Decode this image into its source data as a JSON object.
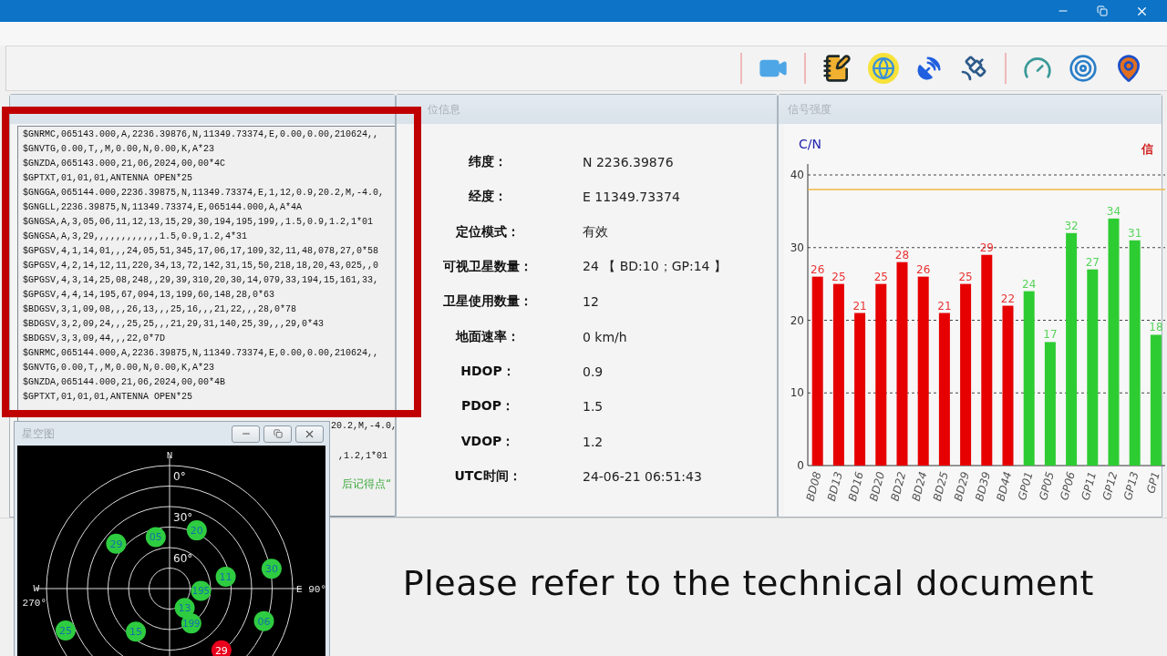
{
  "nmea_panel": {
    "lines": [
      "$GNRMC,065143.000,A,2236.39876,N,11349.73374,E,0.00,0.00,210624,,",
      "$GNVTG,0.00,T,,M,0.00,N,0.00,K,A*23",
      "$GNZDA,065143.000,21,06,2024,00,00*4C",
      "$GPTXT,01,01,01,ANTENNA OPEN*25",
      "$GNGGA,065144.000,2236.39875,N,11349.73374,E,1,12,0.9,20.2,M,-4.0,",
      "$GNGLL,2236.39875,N,11349.73374,E,065144.000,A,A*4A",
      "$GNGSA,A,3,05,06,11,12,13,15,29,30,194,195,199,,1.5,0.9,1.2,1*01",
      "$GNGSA,A,3,29,,,,,,,,,,,,1.5,0.9,1.2,4*31",
      "$GPGSV,4,1,14,01,,,24,05,51,345,17,06,17,109,32,11,48,078,27,0*58",
      "$GPGSV,4,2,14,12,11,220,34,13,72,142,31,15,50,218,18,20,43,025,,0",
      "$GPGSV,4,3,14,25,08,248,,29,39,310,20,30,14,079,33,194,15,161,33,",
      "$GPGSV,4,4,14,195,67,094,13,199,60,148,28,0*63",
      "$BDGSV,3,1,09,08,,,26,13,,,25,16,,,21,22,,,28,0*78",
      "$BDGSV,3,2,09,24,,,25,25,,,21,29,31,140,25,39,,,29,0*43",
      "$BDGSV,3,3,09,44,,,22,0*7D",
      "$GNRMC,065144.000,A,2236.39875,N,11349.73374,E,0.00,0.00,210624,,",
      "$GNVTG,0.00,T,,M,0.00,N,0.00,K,A*23",
      "$GNZDA,065144.000,21,06,2024,00,00*4B",
      "$GPTXT,01,01,01,ANTENNA OPEN*25"
    ],
    "covered_tails": [
      "20.2,M,-4.0,",
      ",1.2,1*01"
    ],
    "status_fragment": "后记得点“"
  },
  "position_panel": {
    "title": "位信息",
    "rows": [
      {
        "label": "纬度：",
        "value": "N 2236.39876"
      },
      {
        "label": "经度：",
        "value": "E 11349.73374"
      },
      {
        "label": "定位模式：",
        "value": "有效"
      },
      {
        "label": "可视卫星数量：",
        "value": "24 【 BD:10；GP:14 】"
      },
      {
        "label": "卫星使用数量：",
        "value": "12"
      },
      {
        "label": "地面速率：",
        "value": "0 km/h"
      },
      {
        "label": "HDOP：",
        "value": "0.9"
      },
      {
        "label": "PDOP：",
        "value": "1.5"
      },
      {
        "label": "VDOP：",
        "value": "1.2"
      },
      {
        "label": "UTC时间：",
        "value": "24-06-21 06:51:43"
      }
    ]
  },
  "signal_panel": {
    "title": "信号强度",
    "legend_fragment": "信",
    "chart_data": {
      "type": "bar",
      "ylabel": "C/N",
      "categories": [
        "BD08",
        "BD13",
        "BD16",
        "BD20",
        "BD22",
        "BD24",
        "BD25",
        "BD29",
        "BD39",
        "BD44",
        "GP01",
        "GP05",
        "GP06",
        "GP11",
        "GP12",
        "GP13",
        "GP1"
      ],
      "series": [
        {
          "color": "#e60000",
          "values": [
            26,
            25,
            21,
            25,
            28,
            26,
            21,
            25,
            29,
            22,
            null,
            null,
            null,
            null,
            null,
            null,
            null
          ]
        },
        {
          "color": "#2ecc33",
          "values": [
            null,
            null,
            null,
            null,
            null,
            null,
            null,
            null,
            null,
            null,
            24,
            17,
            32,
            27,
            34,
            31,
            18
          ]
        }
      ],
      "ylim": [
        0,
        40
      ],
      "yticks": [
        0,
        10,
        20,
        30,
        40
      ],
      "grid": true,
      "data_labels": true,
      "ref_lines": [
        {
          "axis": "y",
          "value": 38
        }
      ]
    }
  },
  "sky_window": {
    "title": "星空图",
    "compass_labels": [
      {
        "kind": "north",
        "text": "N"
      },
      {
        "kind": "east",
        "text": "E 90°"
      },
      {
        "kind": "west",
        "text": "W"
      },
      {
        "kind": "west_degree",
        "text": "270°"
      }
    ],
    "ring_labels": [
      "0°",
      "30°",
      "60°"
    ],
    "satellites": [
      {
        "label": "05",
        "color": "#2ecc40"
      },
      {
        "label": "20",
        "color": "#2ecc40"
      },
      {
        "label": "29",
        "color": "#2ecc40"
      },
      {
        "label": "30",
        "color": "#2ecc40"
      },
      {
        "label": "11",
        "color": "#2ecc40"
      },
      {
        "label": "195",
        "color": "#2ecc40"
      },
      {
        "label": "13",
        "color": "#2ecc40"
      },
      {
        "label": "199",
        "color": "#2ecc40"
      },
      {
        "label": "06",
        "color": "#2ecc40"
      },
      {
        "label": "15",
        "color": "#2ecc40"
      },
      {
        "label": "25",
        "color": "#2ecc40"
      },
      {
        "label": "29",
        "color": "#e8001c"
      }
    ]
  },
  "caption": "Please refer to the technical document"
}
